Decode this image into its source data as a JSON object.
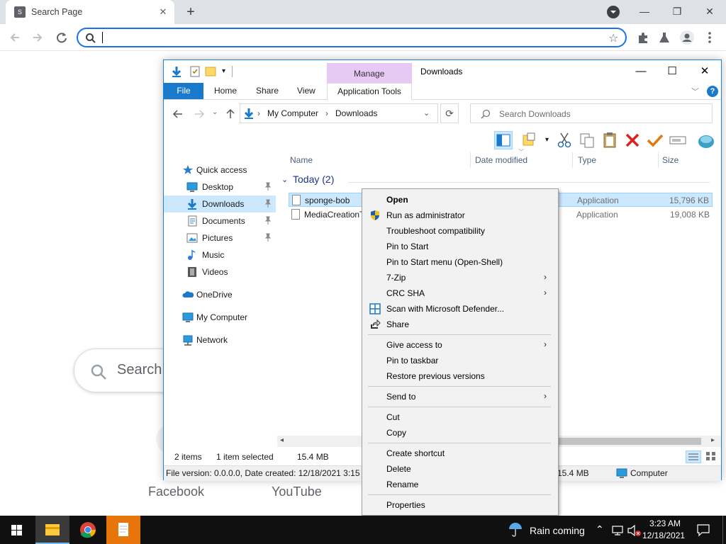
{
  "browser": {
    "tab_title": "Search Page",
    "tab_favicon_letter": "S",
    "close_glyph": "✕",
    "new_tab_glyph": "+",
    "min_glyph": "—",
    "max_glyph": "❐",
    "win_close_glyph": "✕"
  },
  "google": {
    "search_placeholder": "Search",
    "shortcuts": [
      "Facebook",
      "YouTube"
    ]
  },
  "explorer": {
    "window_title": "Downloads",
    "contextual_tab": "Manage",
    "ribbon_tabs": {
      "file": "File",
      "home": "Home",
      "share": "Share",
      "view": "View",
      "app_tools": "Application Tools"
    },
    "breadcrumb": [
      "My Computer",
      "Downloads"
    ],
    "breadcrumb_sep": "›",
    "search_placeholder": "Search Downloads",
    "nav": {
      "quick_access": "Quick access",
      "desktop": "Desktop",
      "downloads": "Downloads",
      "documents": "Documents",
      "pictures": "Pictures",
      "music": "Music",
      "videos": "Videos",
      "onedrive": "OneDrive",
      "my_computer": "My Computer",
      "network": "Network"
    },
    "columns": {
      "name": "Name",
      "date_modified": "Date modified",
      "type": "Type",
      "size": "Size"
    },
    "group_label": "Today (2)",
    "files": [
      {
        "name": "sponge-bob",
        "type": "Application",
        "size": "15,796 KB",
        "selected": true
      },
      {
        "name": "MediaCreationT",
        "type": "Application",
        "size": "19,008 KB",
        "selected": false
      }
    ],
    "status": {
      "items": "2 items",
      "selected": "1 item selected",
      "size": "15.4 MB"
    },
    "details_bar": {
      "info": "File version: 0.0.0.0, Date created: 12/18/2021 3:15 AM",
      "size": "15.4 MB",
      "location": "Computer"
    }
  },
  "context_menu": {
    "open": "Open",
    "run_admin": "Run as administrator",
    "troubleshoot": "Troubleshoot compatibility",
    "pin_start": "Pin to Start",
    "pin_start_openshell": "Pin to Start menu (Open-Shell)",
    "seven_zip": "7-Zip",
    "crc_sha": "CRC SHA",
    "scan_defender": "Scan with Microsoft Defender...",
    "share": "Share",
    "give_access": "Give access to",
    "pin_taskbar": "Pin to taskbar",
    "restore_versions": "Restore previous versions",
    "send_to": "Send to",
    "cut": "Cut",
    "copy": "Copy",
    "create_shortcut": "Create shortcut",
    "delete": "Delete",
    "rename": "Rename",
    "properties": "Properties",
    "submenu_arrow": "›"
  },
  "taskbar": {
    "weather": "Rain coming",
    "time": "3:23 AM",
    "date": "12/18/2021"
  },
  "colors": {
    "accent": "#1a73e8",
    "explorer_blue": "#1979ca",
    "selection": "#cce8ff",
    "manage_band": "#e8c8f5"
  }
}
